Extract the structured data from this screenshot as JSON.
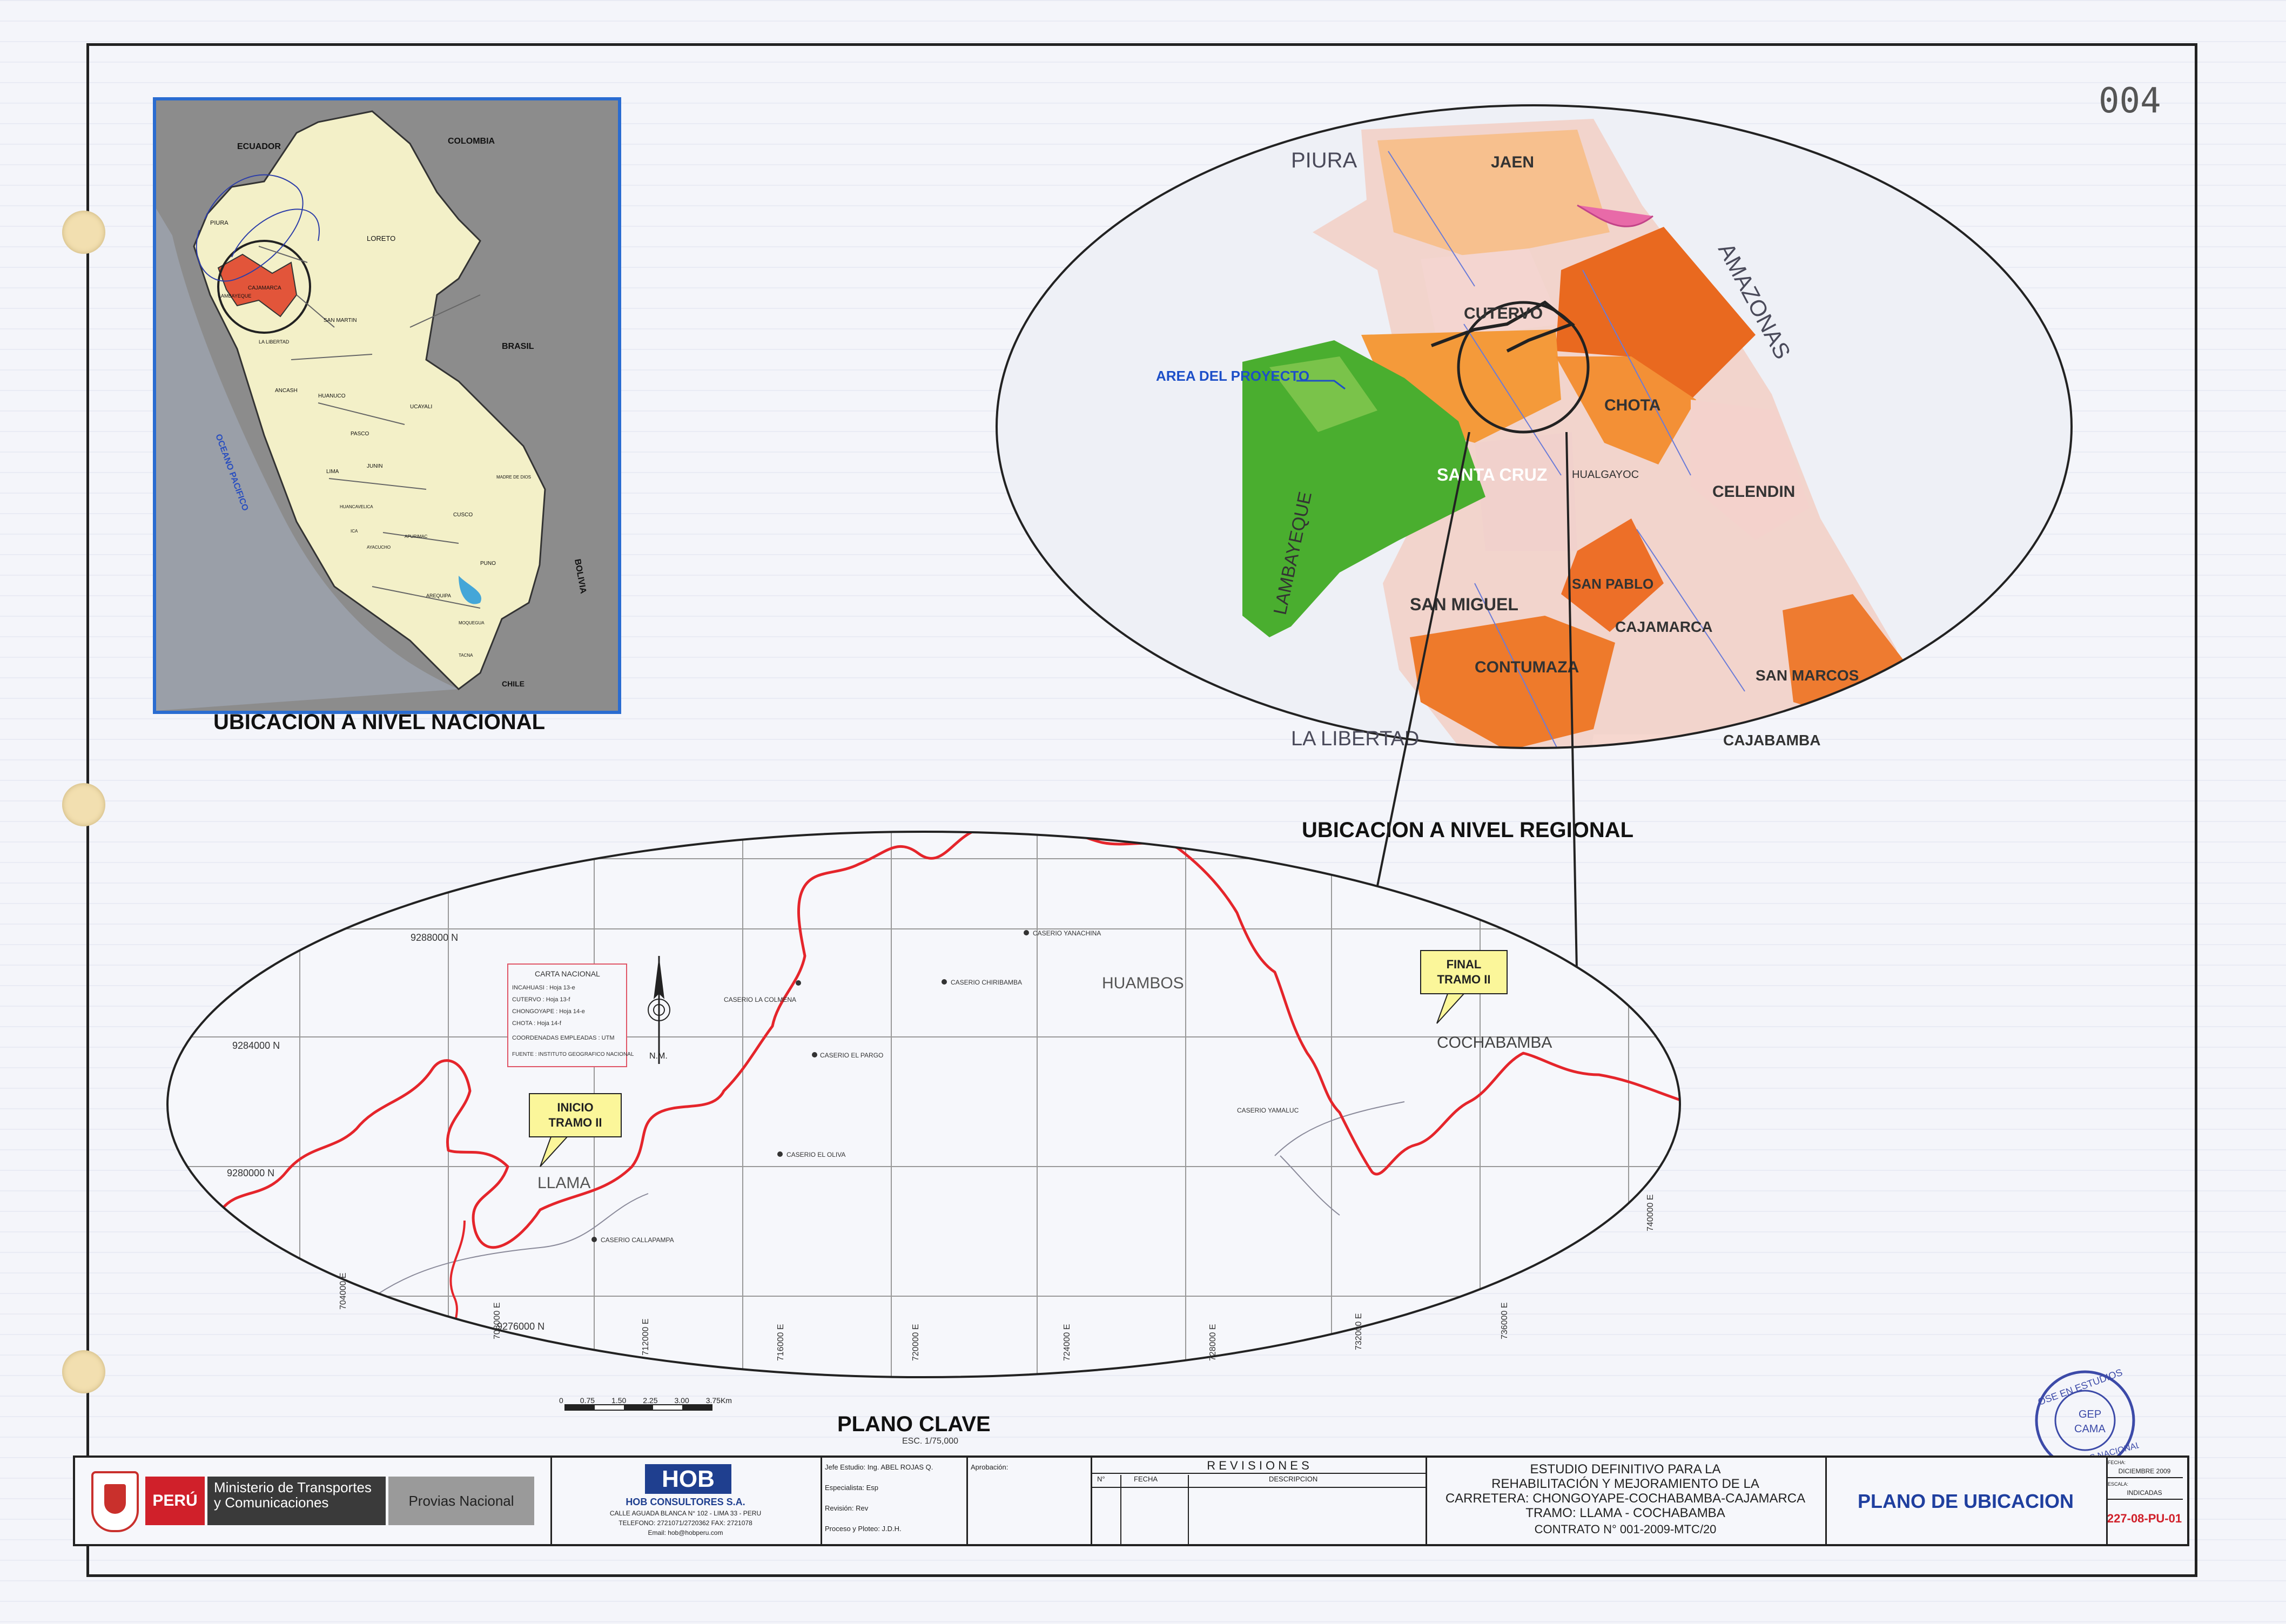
{
  "sheet_number": "004",
  "national_map": {
    "countries": [
      "ECUADOR",
      "COLOMBIA",
      "BRASIL",
      "BOLIVIA",
      "CHILE"
    ],
    "ocean": "OCEANO PACIFICO",
    "regions": [
      "PIURA",
      "LORETO",
      "SAN MARTIN",
      "CAJAMARCA",
      "LAMBAYEQUE",
      "LA LIBERTAD",
      "ANCASH",
      "HUANUCO",
      "UCAYALI",
      "PASCO",
      "JUNIN",
      "LIMA",
      "HUANCAVELICA",
      "MADRE DE DIOS",
      "CUSCO",
      "APURIMAC",
      "AYACUCHO",
      "ICA",
      "PUNO",
      "AREQUIPA",
      "MOQUEGUA",
      "TACNA"
    ],
    "caption": "UBICACION A NIVEL NACIONAL"
  },
  "regional_map": {
    "neighbors": [
      "PIURA",
      "AMAZONAS",
      "LAMBAYEQUE",
      "LA LIBERTAD"
    ],
    "provinces": [
      "JAEN",
      "CUTERVO",
      "CHOTA",
      "SANTA CRUZ",
      "HUALGAYOC",
      "CELENDIN",
      "SAN MIGUEL",
      "SAN PABLO",
      "CAJAMARCA",
      "CONTUMAZA",
      "SAN MARCOS",
      "CAJABAMBA"
    ],
    "project_area_label": "AREA DEL PROYECTO",
    "caption": "UBICACION A NIVEL REGIONAL"
  },
  "key_plan": {
    "caption": "PLANO CLAVE",
    "scale_note": "ESC. 1/75,000",
    "scale_bar": [
      "0",
      "0.75",
      "1.50",
      "2.25",
      "3.00",
      "3.75Km"
    ],
    "north_label": "N.M.",
    "grid_n_labels": [
      "9288000 N",
      "9284000 N",
      "9280000 N",
      "9276000 N"
    ],
    "grid_e_labels": [
      "704000 E",
      "708000 E",
      "712000 E",
      "716000 E",
      "720000 E",
      "724000 E",
      "728000 E",
      "732000 E",
      "736000 E",
      "740000 E"
    ],
    "towns": [
      "LLAMA",
      "HUAMBOS",
      "COCHABAMBA"
    ],
    "caserios": [
      "CASERIO YANACHINA",
      "CASERIO CHIRIBAMBA",
      "CASERIO LA COLMENA",
      "CASERIO EL PARGO",
      "CASERIO EL OLIVA",
      "CASERIO CALLAPAMPA",
      "CASERIO YAMALUC"
    ],
    "start_label": "INICIO TRAMO II",
    "end_label": "FINAL TRAMO II",
    "legend": {
      "title": "CARTA NACIONAL",
      "rows": [
        "INCAHUASI : Hoja 13-e",
        "CUTERVO : Hoja 13-f",
        "CHONGOYAPE : Hoja 14-e",
        "CHOTA : Hoja 14-f",
        "COORDENADAS EMPLEADAS : UTM",
        "FUENTE : INSTITUTO GEOGRAFICO NACIONAL"
      ]
    }
  },
  "title_block": {
    "ministry": "Ministerio de Transportes y Comunicaciones",
    "peru": "PERÚ",
    "provias": "Provias Nacional",
    "consultant_logo": "HOB",
    "consultant_name": "HOB CONSULTORES S.A.",
    "consultant_address": "CALLE AGUADA BLANCA N° 102 - LIMA 33 - PERU",
    "consultant_phone": "TELEFONO: 2721071/2720362 FAX: 2721078",
    "consultant_email": "Email: hob@hobperu.com",
    "staff": [
      {
        "role": "Jefe Estudio:",
        "name": "Ing. ABEL ROJAS Q."
      },
      {
        "role": "Especialista:",
        "name": "Esp"
      },
      {
        "role": "Revisión:",
        "name": "Rev"
      },
      {
        "role": "Proceso y Ploteo:",
        "name": "J.D.H."
      }
    ],
    "approval": "Aprobación:",
    "revisions_title": "R E V I S I O N E S",
    "revisions_cols": [
      "N°",
      "FECHA",
      "DESCRIPCION"
    ],
    "project_lines": [
      "ESTUDIO DEFINITIVO PARA LA",
      "REHABILITACIÓN Y MEJORAMIENTO DE LA",
      "CARRETERA: CHONGOYAPE-COCHABAMBA-CAJAMARCA",
      "TRAMO: LLAMA - COCHABAMBA"
    ],
    "contract": "CONTRATO N° 001-2009-MTC/20",
    "drawing_title": "PLANO DE UBICACION",
    "date_label": "FECHA:",
    "date_value": "DICIEMBRE 2009",
    "scale_label": "ESCALA:",
    "scale_value": "INDICADAS",
    "drawing_code": "227-08-PU-01",
    "stamp": [
      "OSE EN ESTUDIOS",
      "GEP",
      "CAMA",
      "PROVIAS NACIONAL"
    ]
  }
}
